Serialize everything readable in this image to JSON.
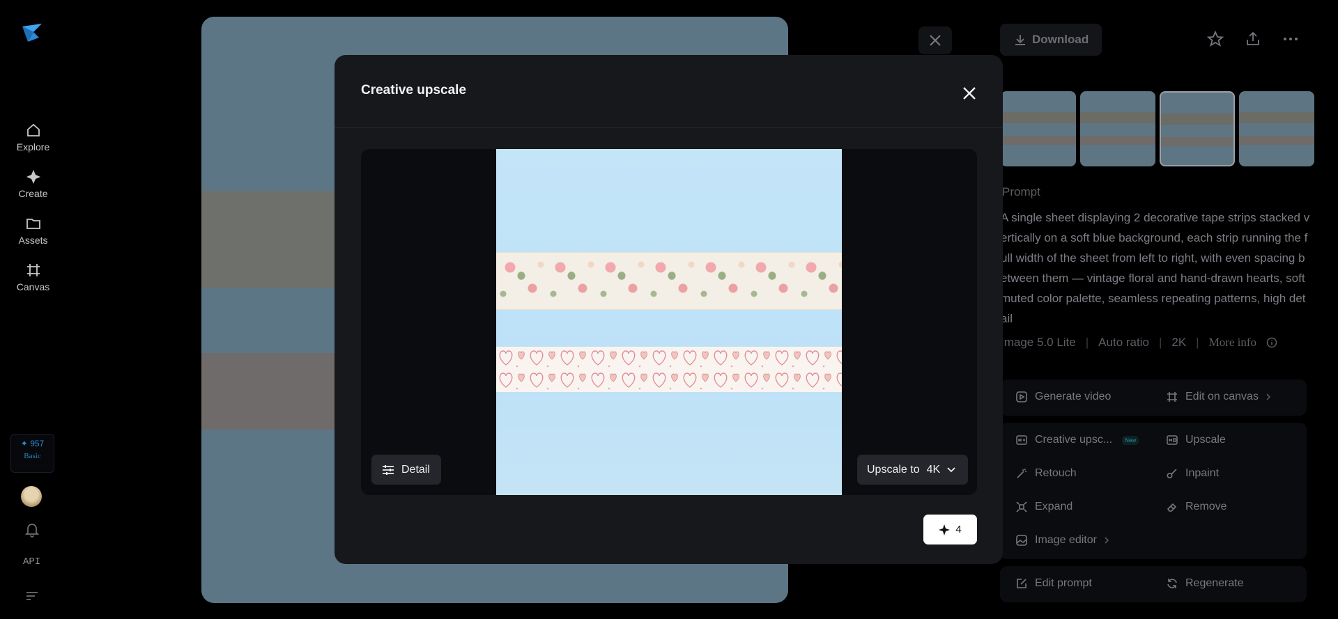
{
  "nav": {
    "items": [
      {
        "label": "Explore",
        "icon": "home-icon"
      },
      {
        "label": "Create",
        "icon": "sparkle-icon"
      },
      {
        "label": "Assets",
        "icon": "folder-icon"
      },
      {
        "label": "Canvas",
        "icon": "frame-icon"
      }
    ],
    "credits": {
      "amount": "957",
      "plan": "Basic"
    },
    "api_label": "API"
  },
  "header": {
    "download_label": "Download"
  },
  "details": {
    "prompt_label": "Prompt",
    "prompt_text": "A single sheet displaying 2 decorative tape strips stacked vertically on a soft blue background, each strip running the full width of the sheet from left to right, with even spacing between them — vintage floral and hand-drawn hearts, soft muted color palette, seamless repeating patterns, high detail",
    "model": "Image 5.0 Lite",
    "ratio": "Auto ratio",
    "resolution": "2K",
    "more_info": "More info"
  },
  "actions": {
    "generate_video": "Generate video",
    "edit_on_canvas": "Edit on canvas",
    "creative_upscale": "Creative upsc...",
    "new_badge": "New",
    "upscale": "Upscale",
    "retouch": "Retouch",
    "inpaint": "Inpaint",
    "expand": "Expand",
    "remove": "Remove",
    "image_editor": "Image editor",
    "edit_prompt": "Edit prompt",
    "regenerate": "Regenerate"
  },
  "modal": {
    "title": "Creative upscale",
    "detail_label": "Detail",
    "upscale_prefix": "Upscale to",
    "upscale_value": "4K",
    "cost": "4"
  },
  "colors": {
    "accent": "#2a8fd6",
    "modal_bg": "#17181c",
    "stage_bg": "#0b0c0f"
  }
}
